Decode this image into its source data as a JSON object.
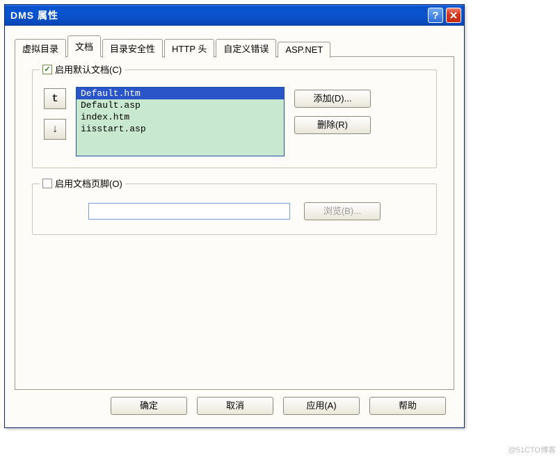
{
  "window": {
    "title": "DMS 属性"
  },
  "tabs": [
    {
      "label": "虚拟目录"
    },
    {
      "label": "文档"
    },
    {
      "label": "目录安全性"
    },
    {
      "label": "HTTP 头"
    },
    {
      "label": "自定义错误"
    },
    {
      "label": "ASP.NET"
    }
  ],
  "active_tab_index": 1,
  "group_default": {
    "checkbox_checked": true,
    "label": "启用默认文档(C)",
    "up_glyph": "t",
    "down_glyph": "↓",
    "list": [
      "Default.htm",
      "Default.asp",
      "index.htm",
      "iisstart.asp"
    ],
    "selected_index": 0,
    "btn_add": "添加(D)...",
    "btn_remove": "删除(R)"
  },
  "group_footer": {
    "checkbox_checked": false,
    "label": "启用文档页脚(O)",
    "input_value": "",
    "btn_browse": "浏览(B)..."
  },
  "dialog_buttons": {
    "ok": "确定",
    "cancel": "取消",
    "apply": "应用(A)",
    "help": "帮助"
  },
  "watermark": "@51CTO博客"
}
